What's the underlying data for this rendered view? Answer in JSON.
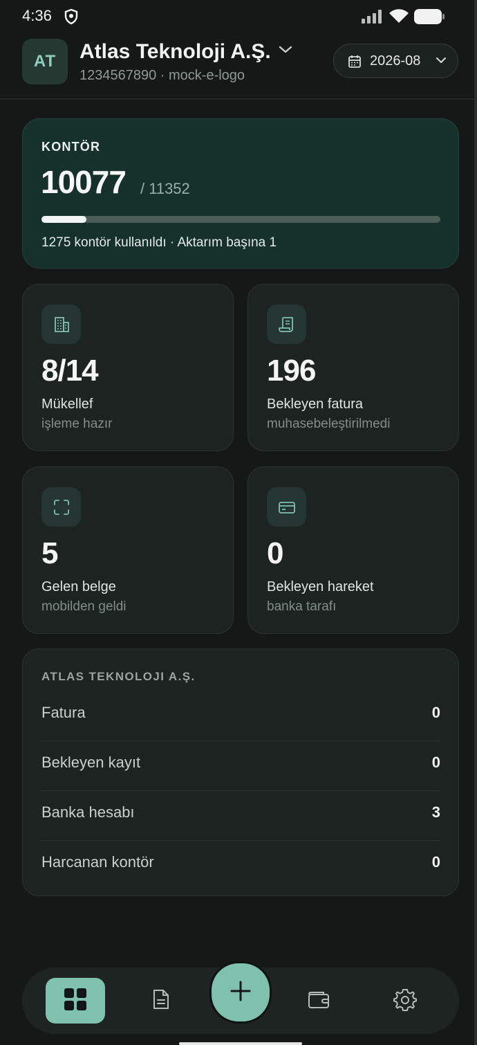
{
  "status_bar": {
    "time": "4:36"
  },
  "header": {
    "avatar_initials": "AT",
    "company_name": "Atlas Teknoloji A.Ş.",
    "company_sub": "1234567890 · mock-e-logo",
    "period": "2026-08"
  },
  "kontor": {
    "title": "KONTÖR",
    "remaining": "10077",
    "total": "/ 11352",
    "progress_fraction": 0.112,
    "note": "1275 kontör kullanıldı · Aktarım başına 1"
  },
  "stats": [
    {
      "icon": "building-icon",
      "value": "8/14",
      "label": "Mükellef",
      "sub": "işleme hazır"
    },
    {
      "icon": "receipt-icon",
      "value": "196",
      "label": "Bekleyen fatura",
      "sub": "muhasebeleştirilmedi"
    },
    {
      "icon": "scan-icon",
      "value": "5",
      "label": "Gelen belge",
      "sub": "mobilden geldi"
    },
    {
      "icon": "card-icon",
      "value": "0",
      "label": "Bekleyen hareket",
      "sub": "banka tarafı"
    }
  ],
  "summary": {
    "title": "ATLAS TEKNOLOJI A.Ş.",
    "rows": [
      {
        "key": "Fatura",
        "value": "0"
      },
      {
        "key": "Bekleyen kayıt",
        "value": "0"
      },
      {
        "key": "Banka hesabı",
        "value": "3"
      },
      {
        "key": "Harcanan kontör",
        "value": "0"
      }
    ]
  },
  "nav": {
    "items": [
      "grid-icon",
      "document-icon",
      "plus-icon",
      "wallet-icon",
      "settings-icon"
    ],
    "accent": "#7fc1ad"
  }
}
